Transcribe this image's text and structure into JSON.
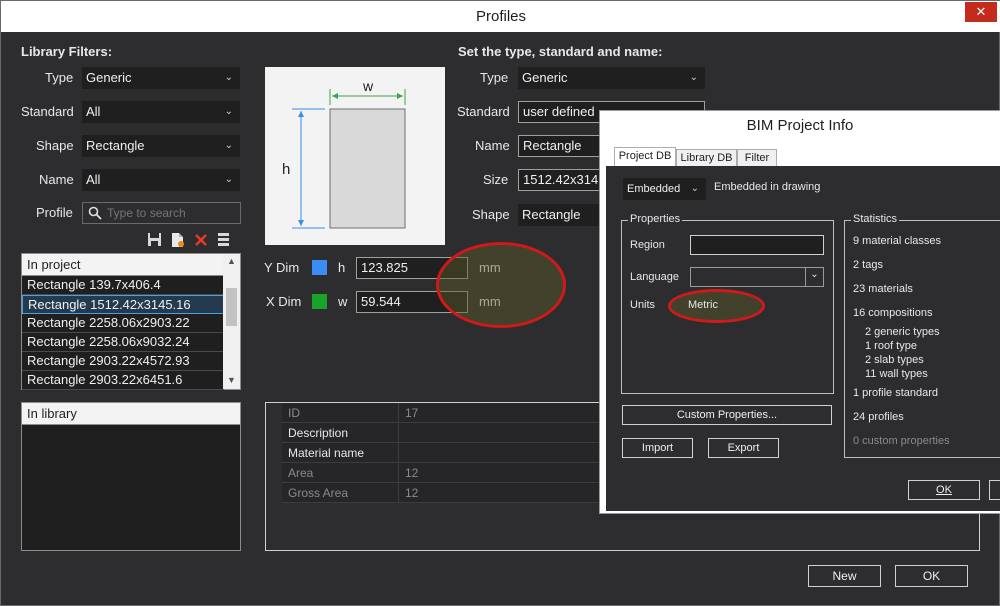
{
  "window": {
    "title": "Profiles",
    "close_glyph": "✕"
  },
  "filters": {
    "heading": "Library Filters:",
    "type_label": "Type",
    "type_value": "Generic",
    "standard_label": "Standard",
    "standard_value": "All",
    "shape_label": "Shape",
    "shape_value": "Rectangle",
    "name_label": "Name",
    "name_value": "All",
    "profile_label": "Profile",
    "search_placeholder": "Type to search"
  },
  "in_project": {
    "header": "In project",
    "items": [
      "Rectangle 139.7x406.4",
      "Rectangle 1512.42x3145.16",
      "Rectangle 2258.06x2903.22",
      "Rectangle 2258.06x9032.24",
      "Rectangle 2903.22x4572.93",
      "Rectangle 2903.22x6451.6"
    ],
    "selected_index": 1
  },
  "in_library": {
    "header": "In library"
  },
  "diagram": {
    "w_label": "w",
    "h_label": "h"
  },
  "dims": {
    "y_label": "Y Dim",
    "y_color": "#3b8cf5",
    "y_var": "h",
    "y_value": "123.825",
    "y_unit": "mm",
    "x_label": "X Dim",
    "x_color": "#1aa32b",
    "x_var": "w",
    "x_value": "59.544",
    "x_unit": "mm"
  },
  "set": {
    "heading": "Set the type, standard and name:",
    "type_label": "Type",
    "type_value": "Generic",
    "standard_label": "Standard",
    "standard_value": "user defined",
    "name_label": "Name",
    "name_value": "Rectangle",
    "size_label": "Size",
    "size_value": "1512.42x314",
    "shape_label": "Shape",
    "shape_value": "Rectangle"
  },
  "properties": [
    {
      "key": "ID",
      "value": "17",
      "dim": true
    },
    {
      "key": "Description",
      "value": "",
      "dim": false
    },
    {
      "key": "Material name",
      "value": "",
      "dim": false
    },
    {
      "key": "Area",
      "value": "12",
      "dim": true
    },
    {
      "key": "Gross Area",
      "value": "12",
      "dim": true
    }
  ],
  "buttons": {
    "new": "New",
    "ok": "OK"
  },
  "bim": {
    "title": "BIM Project Info",
    "tabs": [
      "Project DB",
      "Library DB",
      "Filter"
    ],
    "storage_value": "Embedded",
    "storage_desc": "Embedded in drawing",
    "properties_title": "Properties",
    "region_label": "Region",
    "region_value": "",
    "language_label": "Language",
    "language_value": "",
    "units_label": "Units",
    "units_value": "Metric",
    "custom_props": "Custom Properties...",
    "import": "Import",
    "export": "Export",
    "statistics_title": "Statistics",
    "stats": {
      "material_classes": "9 material classes",
      "tags": "2 tags",
      "materials": "23 materials",
      "compositions": "16 compositions",
      "generic": "2 generic types",
      "roof": "1 roof type",
      "slab": "2 slab types",
      "wall": "11 wall types",
      "profile_std": "1 profile standard",
      "profiles": "24 profiles",
      "custom": "0 custom properties"
    },
    "ok": "OK"
  },
  "icons": [
    "save-icon",
    "new-file-icon",
    "delete-icon",
    "database-icon",
    "search-icon",
    "chevron-down-icon"
  ]
}
